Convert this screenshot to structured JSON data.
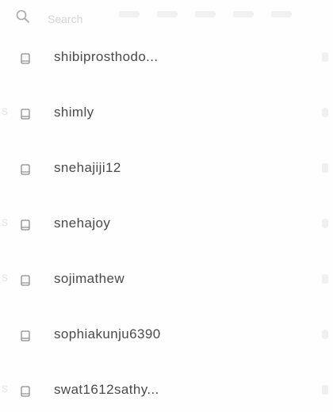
{
  "search": {
    "placeholder": "Search",
    "icon": "search-icon"
  },
  "list": {
    "item_icon": "document-icon",
    "items": [
      {
        "letter": "",
        "label": "shibiprosthodo..."
      },
      {
        "letter": "S",
        "label": "shimly"
      },
      {
        "letter": "",
        "label": "snehajiji12"
      },
      {
        "letter": "S",
        "label": "snehajoy"
      },
      {
        "letter": "S",
        "label": "sojimathew"
      },
      {
        "letter": "",
        "label": "sophiakunju6390"
      },
      {
        "letter": "S",
        "label": "swat1612sathy..."
      }
    ]
  }
}
